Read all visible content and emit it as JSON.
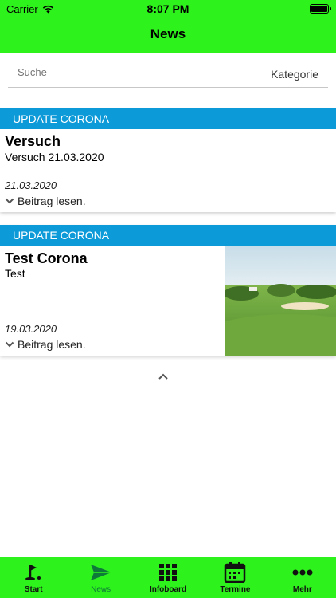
{
  "status": {
    "carrier": "Carrier",
    "time": "8:07 PM"
  },
  "nav": {
    "title": "News"
  },
  "search": {
    "placeholder": "Suche",
    "category_label": "Kategorie"
  },
  "posts": [
    {
      "category": "UPDATE CORONA",
      "title": "Versuch",
      "subtitle": "Versuch 21.03.2020",
      "date": "21.03.2020",
      "read_more": "Beitrag lesen.",
      "has_image": false
    },
    {
      "category": "UPDATE CORONA",
      "title": "Test Corona",
      "subtitle": "Test",
      "date": "19.03.2020",
      "read_more": "Beitrag lesen.",
      "has_image": true,
      "image_icon": "golf-course-photo"
    }
  ],
  "tabs": [
    {
      "label": "Start",
      "icon": "golf-flag-icon",
      "active": false
    },
    {
      "label": "News",
      "icon": "paper-plane-icon",
      "active": true
    },
    {
      "label": "Infoboard",
      "icon": "grid-icon",
      "active": false
    },
    {
      "label": "Termine",
      "icon": "calendar-icon",
      "active": false
    },
    {
      "label": "Mehr",
      "icon": "more-dots-icon",
      "active": false
    }
  ],
  "colors": {
    "accent_green": "#2ef21c",
    "header_blue": "#0c9ad9",
    "active_tab": "#0d7a3a"
  }
}
